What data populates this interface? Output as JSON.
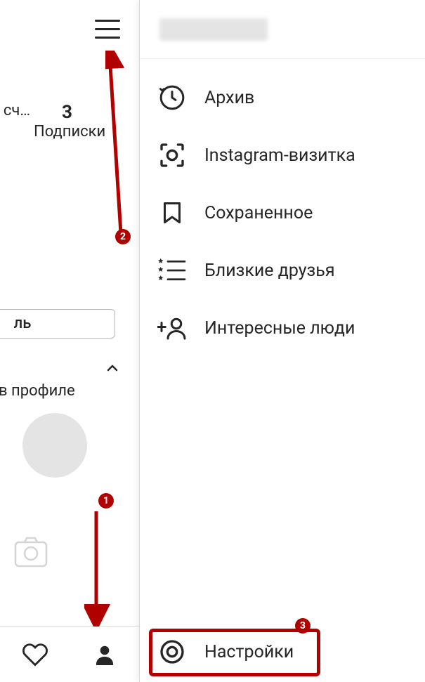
{
  "profile": {
    "follow_count": "3",
    "follow_label": "Подписки",
    "subscribers_label_cut": "сч…",
    "edit_button_cut": "ль",
    "profile_text_cut": "в профиле"
  },
  "drawer": {
    "username": "",
    "items": [
      {
        "label": "Архив",
        "icon": "archive-icon"
      },
      {
        "label": "Instagram-визитка",
        "icon": "nametag-icon"
      },
      {
        "label": "Сохраненное",
        "icon": "bookmark-icon"
      },
      {
        "label": "Близкие друзья",
        "icon": "close-friends-icon"
      },
      {
        "label": "Интересные люди",
        "icon": "discover-people-icon"
      }
    ],
    "settings_label": "Настройки"
  },
  "annotations": {
    "badge1": "1",
    "badge2": "2",
    "badge3": "3"
  }
}
